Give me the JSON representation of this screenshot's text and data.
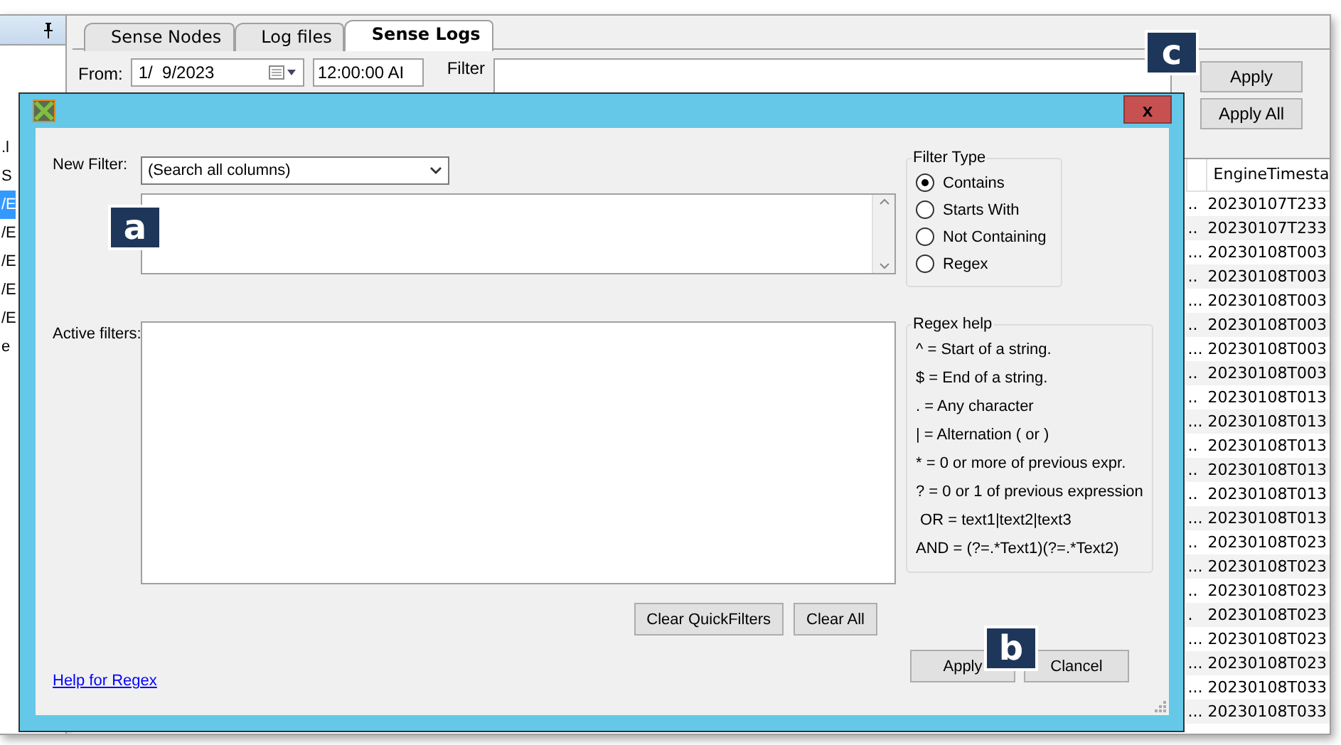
{
  "left_panel": {
    "fragments": [
      {
        "text": ".l",
        "selected": false
      },
      {
        "text": "S",
        "selected": false
      },
      {
        "text": "/E",
        "selected": true
      },
      {
        "text": "/E",
        "selected": false
      },
      {
        "text": "/E",
        "selected": false
      },
      {
        "text": "/E",
        "selected": false
      },
      {
        "text": "/E",
        "selected": false
      },
      {
        "text": "e",
        "selected": false
      }
    ]
  },
  "tabs": [
    {
      "label": "Sense Nodes",
      "selected": false
    },
    {
      "label": "Log files",
      "selected": false
    },
    {
      "label": "Sense Logs",
      "selected": true
    }
  ],
  "filter_bar": {
    "from_label": "From:",
    "from_date": "1/  9/2023",
    "from_time": "12:00:00 AI",
    "filter_label": "Filter",
    "buttons": [
      "Apply",
      "Apply All"
    ]
  },
  "grid": {
    "columns": [
      "",
      "EngineTimesta"
    ],
    "rows": [
      [
        "..",
        "20230107T233"
      ],
      [
        "..",
        "20230107T233"
      ],
      [
        "...",
        "20230108T003"
      ],
      [
        "..",
        "20230108T003"
      ],
      [
        "...",
        "20230108T003"
      ],
      [
        "..",
        "20230108T003"
      ],
      [
        "...",
        "20230108T003"
      ],
      [
        "..",
        "20230108T003"
      ],
      [
        "..",
        "20230108T013"
      ],
      [
        "...",
        "20230108T013"
      ],
      [
        "..",
        "20230108T013"
      ],
      [
        "..",
        "20230108T013"
      ],
      [
        "..",
        "20230108T013"
      ],
      [
        "...",
        "20230108T013"
      ],
      [
        "..",
        "20230108T023"
      ],
      [
        "...",
        "20230108T023"
      ],
      [
        "..",
        "20230108T023"
      ],
      [
        ".",
        "20230108T023"
      ],
      [
        "...",
        "20230108T023"
      ],
      [
        "...",
        "20230108T023"
      ],
      [
        "...",
        "20230108T033"
      ],
      [
        "...",
        "20230108T033"
      ]
    ]
  },
  "dialog": {
    "close": "x",
    "new_filter_label": "New Filter:",
    "column_select": "(Search all columns)",
    "active_filters_label": "Active filters:",
    "clear_buttons": [
      "Clear QuickFilters",
      "Clear All"
    ],
    "help_link": "Help for Regex",
    "filter_type": {
      "title": "Filter Type",
      "options": [
        {
          "label": "Contains",
          "selected": true
        },
        {
          "label": "Starts With",
          "selected": false
        },
        {
          "label": "Not Containing",
          "selected": false
        },
        {
          "label": "Regex",
          "selected": false
        }
      ]
    },
    "regex_help": {
      "title": "Regex help",
      "lines": [
        "^ = Start of a string.",
        "$ = End of a string.",
        ". = Any character",
        "| = Alternation ( or )",
        "* = 0 or more of previous expr.",
        "? = 0 or 1 of previous expression",
        " OR = text1|text2|text3",
        "AND = (?=.*Text1)(?=.*Text2)"
      ]
    },
    "buttons": [
      "Apply",
      "Clancel"
    ]
  },
  "callouts": [
    "a",
    "b",
    "c"
  ]
}
